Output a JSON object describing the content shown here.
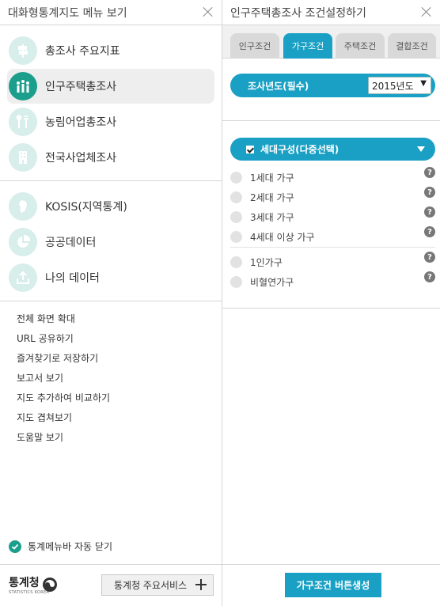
{
  "left_panel": {
    "title": "대화형통계지도 메뉴 보기",
    "primary_menu": [
      {
        "label": "총조사 주요지표",
        "icon": "signpost-icon",
        "active": false
      },
      {
        "label": "인구주택총조사",
        "icon": "people-icon",
        "active": true
      },
      {
        "label": "농림어업총조사",
        "icon": "farming-icon",
        "active": false
      },
      {
        "label": "전국사업체조사",
        "icon": "building-icon",
        "active": false
      }
    ],
    "secondary_menu": [
      {
        "label": "KOSIS(지역통계)",
        "icon": "korea-map-icon"
      },
      {
        "label": "공공데이터",
        "icon": "pie-chart-icon"
      },
      {
        "label": "나의 데이터",
        "icon": "upload-icon"
      }
    ],
    "links": [
      "전체 화면 확대",
      "URL 공유하기",
      "즐겨찾기로 저장하기",
      "보고서 보기",
      "지도 추가하여 비교하기",
      "지도 겹쳐보기",
      "도움말 보기"
    ],
    "auto_close_label": "통계메뉴바 자동 닫기",
    "logo_text": "통계청",
    "logo_sub": "STATISTICS KOREA",
    "service_button": "통계청 주요서비스"
  },
  "right_panel": {
    "title": "인구주택총조사 조건설정하기",
    "tabs": [
      {
        "label": "인구조건",
        "active": false
      },
      {
        "label": "가구조건",
        "active": true
      },
      {
        "label": "주택조건",
        "active": false
      },
      {
        "label": "결합조건",
        "active": false
      }
    ],
    "year_label": "조사년도(필수)",
    "year_value": "2015년도",
    "household_header": "세대구성(다중선택)",
    "options": [
      {
        "label": "1세대 가구",
        "help": "?"
      },
      {
        "label": "2세대 가구",
        "help": "?"
      },
      {
        "label": "3세대 가구",
        "help": "?"
      },
      {
        "label": "4세대 이상 가구",
        "help": "?"
      },
      {
        "label": "1인가구",
        "help": "?"
      },
      {
        "label": "비혈연가구",
        "help": "?"
      }
    ],
    "generate_button": "가구조건 버튼생성"
  },
  "colors": {
    "teal": "#1c9e8c",
    "mint": "#d7eeea",
    "blue": "#19a0c4",
    "tab_inactive": "#d9d9d9"
  }
}
